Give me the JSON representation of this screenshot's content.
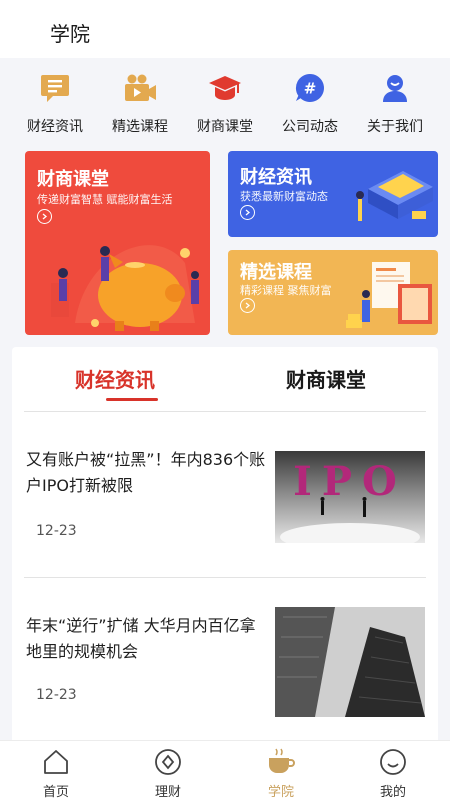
{
  "header": {
    "title": "学院"
  },
  "quick_nav": [
    {
      "label": "财经资讯",
      "icon": "news-icon"
    },
    {
      "label": "精选课程",
      "icon": "video-camera-icon"
    },
    {
      "label": "财商课堂",
      "icon": "graduation-cap-icon"
    },
    {
      "label": "公司动态",
      "icon": "hashtag-icon"
    },
    {
      "label": "关于我们",
      "icon": "user-icon"
    }
  ],
  "banners": {
    "main": {
      "title": "财商课堂",
      "subtitle": "传递财富智慧 赋能财富生活",
      "color": "#ef4b3d"
    },
    "top_right": {
      "title": "财经资讯",
      "subtitle": "获悉最新财富动态",
      "color": "#3f63e3"
    },
    "bottom_right": {
      "title": "精选课程",
      "subtitle": "精彩课程 聚焦财富",
      "color": "#f2b654"
    },
    "ipo_art_text": "IPO"
  },
  "feed": {
    "tabs": [
      {
        "label": "财经资讯",
        "active": true
      },
      {
        "label": "财商课堂",
        "active": false
      }
    ],
    "articles": [
      {
        "title": "又有账户被“拉黑”！年内836个账户IPO打新被限",
        "date": "12-23"
      },
      {
        "title": "年末“逆行”扩储 大华月内百亿拿地里的规模机会",
        "date": "12-23"
      }
    ]
  },
  "tabbar": [
    {
      "label": "首页",
      "icon": "home-icon",
      "active": false
    },
    {
      "label": "理财",
      "icon": "finance-icon",
      "active": false
    },
    {
      "label": "学院",
      "icon": "coffee-cup-icon",
      "active": true
    },
    {
      "label": "我的",
      "icon": "profile-icon",
      "active": false
    }
  ],
  "colors": {
    "accent_red": "#d8332a",
    "gold": "#c9a15e"
  }
}
